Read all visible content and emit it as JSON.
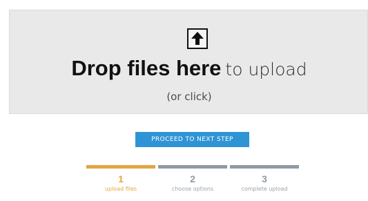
{
  "dropzone": {
    "icon": "upload-arrow-icon",
    "strong_text": "Drop files here",
    "rest_text": "to upload",
    "sub_text": "(or click)"
  },
  "proceed_button": {
    "label": "PROCEED TO NEXT STEP",
    "color": "#2f94d5"
  },
  "steps": [
    {
      "number": "1",
      "label": "upload files",
      "active": true
    },
    {
      "number": "2",
      "label": "choose options",
      "active": false
    },
    {
      "number": "3",
      "label": "complete upload",
      "active": false
    }
  ],
  "colors": {
    "active_step": "#e3a443",
    "inactive_step": "#8f9aa3",
    "dropzone_bg": "#e9e9e9"
  }
}
